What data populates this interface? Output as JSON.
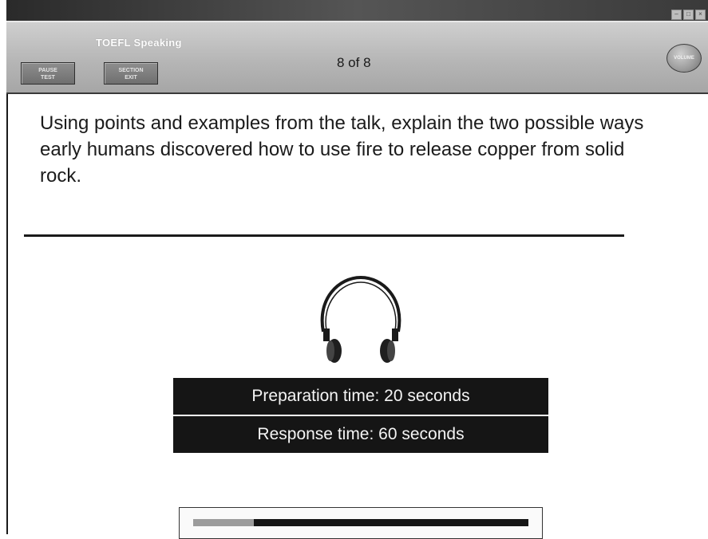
{
  "header": {
    "app_title": "TOEFL Speaking",
    "pause_label": "PAUSE\nTEST",
    "exit_label": "SECTION\nEXIT",
    "counter": "8 of 8",
    "volume_label": "VOLUME"
  },
  "question": {
    "text": "Using points and examples from the talk, explain the two possible ways early humans discovered how to use fire to release copper from solid rock."
  },
  "timers": {
    "preparation": "Preparation time: 20 seconds",
    "response": "Response time: 60 seconds"
  },
  "progress": {
    "fraction": 0.18
  },
  "icons": {
    "headphones": "headphones-icon"
  }
}
